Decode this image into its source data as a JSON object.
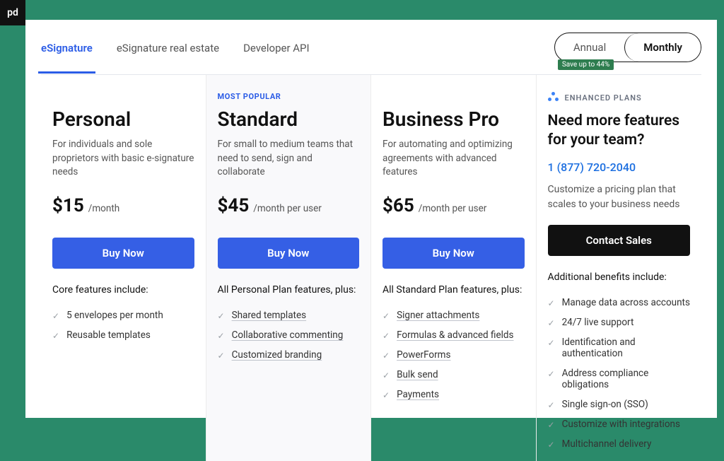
{
  "logo": "pd",
  "tabs": [
    {
      "label": "eSignature",
      "active": true
    },
    {
      "label": "eSignature real estate",
      "active": false
    },
    {
      "label": "Developer API",
      "active": false
    }
  ],
  "billing": {
    "annual": "Annual",
    "monthly": "Monthly",
    "save_badge": "Save up to 44%"
  },
  "plans": [
    {
      "name": "Personal",
      "desc": "For individuals and sole proprietors with basic e-signature needs",
      "price": "$15",
      "per": "/month",
      "cta": "Buy Now",
      "features_heading": "Core features include:",
      "features": [
        {
          "text": "5 envelopes per month",
          "underline": false
        },
        {
          "text": "Reusable templates",
          "underline": false
        }
      ]
    },
    {
      "badge": "MOST POPULAR",
      "name": "Standard",
      "desc": "For small to medium teams that need to send, sign and collaborate",
      "price": "$45",
      "per": "/month per user",
      "cta": "Buy Now",
      "features_heading": "All Personal Plan features, plus:",
      "features": [
        {
          "text": "Shared templates",
          "underline": true
        },
        {
          "text": "Collaborative commenting",
          "underline": true
        },
        {
          "text": "Customized branding",
          "underline": true
        }
      ]
    },
    {
      "name": "Business Pro",
      "desc": "For automating and optimizing agreements with advanced features",
      "price": "$65",
      "per": "/month per user",
      "cta": "Buy Now",
      "features_heading": "All Standard Plan features, plus:",
      "features": [
        {
          "text": "Signer attachments",
          "underline": true
        },
        {
          "text": "Formulas & advanced fields",
          "underline": true
        },
        {
          "text": "PowerForms",
          "underline": true
        },
        {
          "text": "Bulk send",
          "underline": true
        },
        {
          "text": "Payments",
          "underline": true
        }
      ]
    }
  ],
  "enhanced": {
    "label": "ENHANCED PLANS",
    "title": "Need more features for your team?",
    "phone": "1 (877) 720-2040",
    "desc": "Customize a pricing plan that scales to your business needs",
    "cta": "Contact Sales",
    "features_heading": "Additional benefits include:",
    "features": [
      "Manage data across accounts",
      "24/7 live support",
      "Identification and authentication",
      "Address compliance obligations",
      "Single sign-on (SSO)",
      "Customize with integrations",
      "Multichannel delivery"
    ]
  }
}
